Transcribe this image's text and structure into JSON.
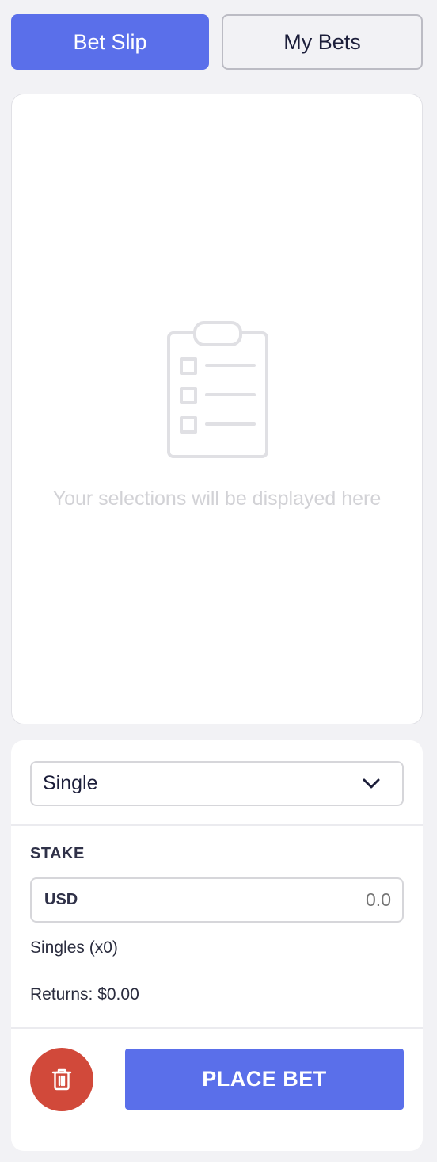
{
  "tabs": [
    {
      "label": "Bet Slip",
      "active": true
    },
    {
      "label": "My Bets",
      "active": false
    }
  ],
  "empty_state": {
    "icon": "clipboard-checklist-icon",
    "message": "Your selections will be displayed here"
  },
  "bet_type": {
    "selected": "Single",
    "icon": "chevron-down-icon"
  },
  "stake": {
    "label": "STAKE",
    "currency": "USD",
    "placeholder": "0.0"
  },
  "summary": {
    "singles": "Singles (x0)",
    "returns": "Returns: $0.00"
  },
  "actions": {
    "clear_icon": "trash-icon",
    "place_bet_label": "PLACE BET"
  },
  "colors": {
    "accent": "#5a6fea",
    "danger": "#d1493a",
    "background": "#f2f2f5"
  }
}
